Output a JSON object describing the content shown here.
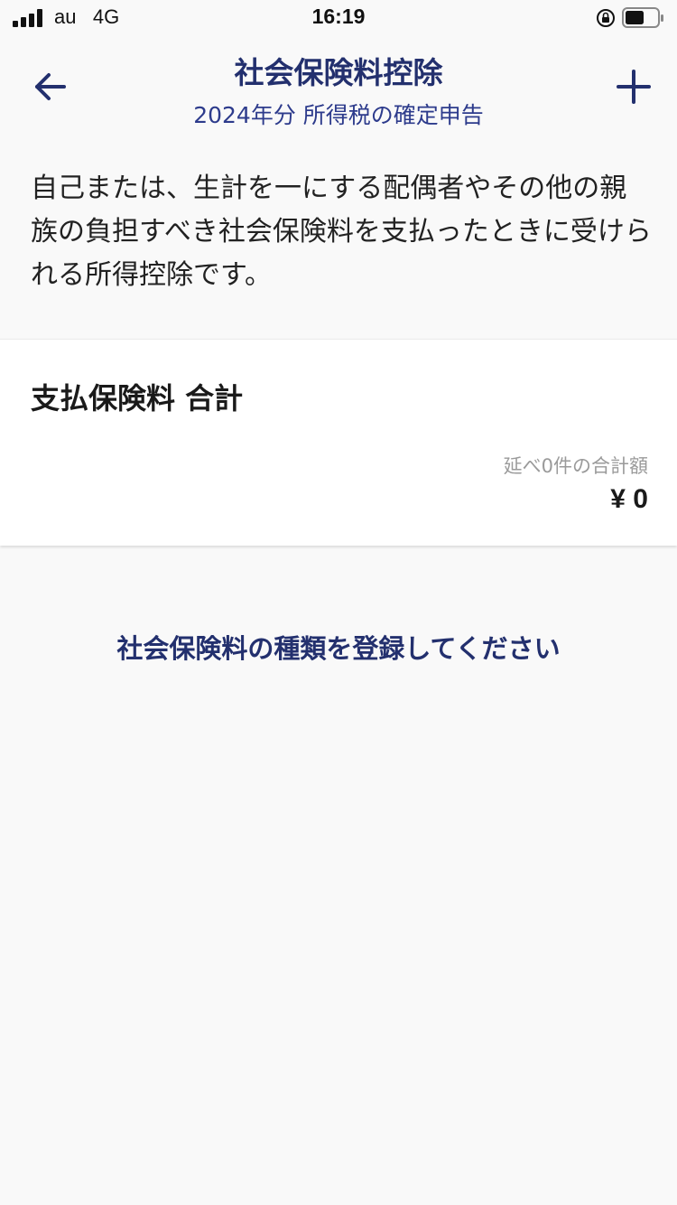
{
  "status_bar": {
    "carrier": "au",
    "network": "4G",
    "time": "16:19",
    "signal_icon": "signal-bars-icon",
    "lock_icon": "orientation-lock-icon",
    "battery_icon": "battery-icon"
  },
  "header": {
    "title": "社会保険料控除",
    "subtitle": "2024年分 所得税の確定申告",
    "back_icon": "arrow-left-icon",
    "add_icon": "plus-icon"
  },
  "description": "自己または、生計を一にする配偶者やその他の親族の負担すべき社会保険料を支払ったときに受けられる所得控除です。",
  "summary_card": {
    "title": "支払保険料 合計",
    "count_label": "延べ0件の合計額",
    "amount": "¥ 0"
  },
  "empty_message": "社会保険料の種類を登録してください",
  "colors": {
    "accent": "#23306e",
    "background": "#f9f9f9",
    "card": "#ffffff"
  }
}
